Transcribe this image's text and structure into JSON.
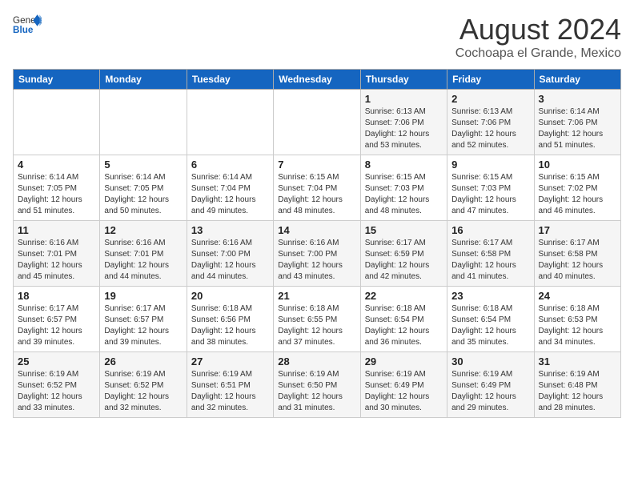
{
  "header": {
    "logo_general": "General",
    "logo_blue": "Blue",
    "month_year": "August 2024",
    "location": "Cochoapa el Grande, Mexico"
  },
  "calendar": {
    "days_of_week": [
      "Sunday",
      "Monday",
      "Tuesday",
      "Wednesday",
      "Thursday",
      "Friday",
      "Saturday"
    ],
    "weeks": [
      [
        {
          "day": "",
          "info": ""
        },
        {
          "day": "",
          "info": ""
        },
        {
          "day": "",
          "info": ""
        },
        {
          "day": "",
          "info": ""
        },
        {
          "day": "1",
          "info": "Sunrise: 6:13 AM\nSunset: 7:06 PM\nDaylight: 12 hours\nand 53 minutes."
        },
        {
          "day": "2",
          "info": "Sunrise: 6:13 AM\nSunset: 7:06 PM\nDaylight: 12 hours\nand 52 minutes."
        },
        {
          "day": "3",
          "info": "Sunrise: 6:14 AM\nSunset: 7:06 PM\nDaylight: 12 hours\nand 51 minutes."
        }
      ],
      [
        {
          "day": "4",
          "info": "Sunrise: 6:14 AM\nSunset: 7:05 PM\nDaylight: 12 hours\nand 51 minutes."
        },
        {
          "day": "5",
          "info": "Sunrise: 6:14 AM\nSunset: 7:05 PM\nDaylight: 12 hours\nand 50 minutes."
        },
        {
          "day": "6",
          "info": "Sunrise: 6:14 AM\nSunset: 7:04 PM\nDaylight: 12 hours\nand 49 minutes."
        },
        {
          "day": "7",
          "info": "Sunrise: 6:15 AM\nSunset: 7:04 PM\nDaylight: 12 hours\nand 48 minutes."
        },
        {
          "day": "8",
          "info": "Sunrise: 6:15 AM\nSunset: 7:03 PM\nDaylight: 12 hours\nand 48 minutes."
        },
        {
          "day": "9",
          "info": "Sunrise: 6:15 AM\nSunset: 7:03 PM\nDaylight: 12 hours\nand 47 minutes."
        },
        {
          "day": "10",
          "info": "Sunrise: 6:15 AM\nSunset: 7:02 PM\nDaylight: 12 hours\nand 46 minutes."
        }
      ],
      [
        {
          "day": "11",
          "info": "Sunrise: 6:16 AM\nSunset: 7:01 PM\nDaylight: 12 hours\nand 45 minutes."
        },
        {
          "day": "12",
          "info": "Sunrise: 6:16 AM\nSunset: 7:01 PM\nDaylight: 12 hours\nand 44 minutes."
        },
        {
          "day": "13",
          "info": "Sunrise: 6:16 AM\nSunset: 7:00 PM\nDaylight: 12 hours\nand 44 minutes."
        },
        {
          "day": "14",
          "info": "Sunrise: 6:16 AM\nSunset: 7:00 PM\nDaylight: 12 hours\nand 43 minutes."
        },
        {
          "day": "15",
          "info": "Sunrise: 6:17 AM\nSunset: 6:59 PM\nDaylight: 12 hours\nand 42 minutes."
        },
        {
          "day": "16",
          "info": "Sunrise: 6:17 AM\nSunset: 6:58 PM\nDaylight: 12 hours\nand 41 minutes."
        },
        {
          "day": "17",
          "info": "Sunrise: 6:17 AM\nSunset: 6:58 PM\nDaylight: 12 hours\nand 40 minutes."
        }
      ],
      [
        {
          "day": "18",
          "info": "Sunrise: 6:17 AM\nSunset: 6:57 PM\nDaylight: 12 hours\nand 39 minutes."
        },
        {
          "day": "19",
          "info": "Sunrise: 6:17 AM\nSunset: 6:57 PM\nDaylight: 12 hours\nand 39 minutes."
        },
        {
          "day": "20",
          "info": "Sunrise: 6:18 AM\nSunset: 6:56 PM\nDaylight: 12 hours\nand 38 minutes."
        },
        {
          "day": "21",
          "info": "Sunrise: 6:18 AM\nSunset: 6:55 PM\nDaylight: 12 hours\nand 37 minutes."
        },
        {
          "day": "22",
          "info": "Sunrise: 6:18 AM\nSunset: 6:54 PM\nDaylight: 12 hours\nand 36 minutes."
        },
        {
          "day": "23",
          "info": "Sunrise: 6:18 AM\nSunset: 6:54 PM\nDaylight: 12 hours\nand 35 minutes."
        },
        {
          "day": "24",
          "info": "Sunrise: 6:18 AM\nSunset: 6:53 PM\nDaylight: 12 hours\nand 34 minutes."
        }
      ],
      [
        {
          "day": "25",
          "info": "Sunrise: 6:19 AM\nSunset: 6:52 PM\nDaylight: 12 hours\nand 33 minutes."
        },
        {
          "day": "26",
          "info": "Sunrise: 6:19 AM\nSunset: 6:52 PM\nDaylight: 12 hours\nand 32 minutes."
        },
        {
          "day": "27",
          "info": "Sunrise: 6:19 AM\nSunset: 6:51 PM\nDaylight: 12 hours\nand 32 minutes."
        },
        {
          "day": "28",
          "info": "Sunrise: 6:19 AM\nSunset: 6:50 PM\nDaylight: 12 hours\nand 31 minutes."
        },
        {
          "day": "29",
          "info": "Sunrise: 6:19 AM\nSunset: 6:49 PM\nDaylight: 12 hours\nand 30 minutes."
        },
        {
          "day": "30",
          "info": "Sunrise: 6:19 AM\nSunset: 6:49 PM\nDaylight: 12 hours\nand 29 minutes."
        },
        {
          "day": "31",
          "info": "Sunrise: 6:19 AM\nSunset: 6:48 PM\nDaylight: 12 hours\nand 28 minutes."
        }
      ]
    ]
  }
}
